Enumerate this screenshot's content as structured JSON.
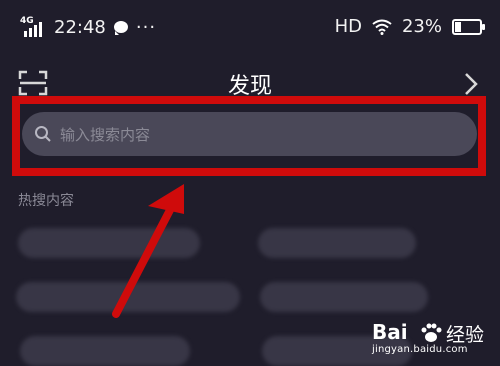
{
  "status_bar": {
    "network": "4G",
    "time": "22:48",
    "more": "···",
    "hd": "HD",
    "battery_percent": "23%",
    "battery_level": 0.23
  },
  "nav": {
    "title": "发现"
  },
  "search": {
    "placeholder": "输入搜索内容"
  },
  "hot": {
    "section_title": "热搜内容"
  },
  "watermark": {
    "brand": "Bai",
    "chinese": "经验",
    "url": "jingyan.baidu.com"
  },
  "colors": {
    "background": "#1f1d2b",
    "highlight": "#cf0b0b",
    "search_bg": "#4a4858"
  },
  "icons": [
    "signal-icon",
    "chat-icon",
    "wifi-icon",
    "battery-icon",
    "scan-icon",
    "chevron-right-icon",
    "search-icon",
    "arrow-annotation"
  ]
}
